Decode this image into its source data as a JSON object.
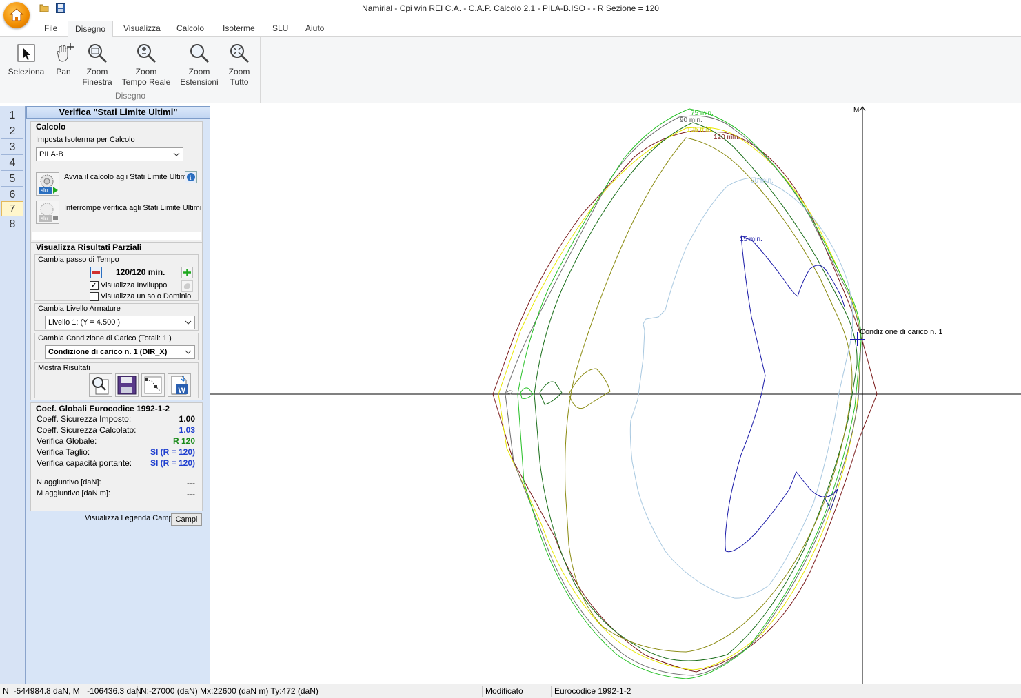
{
  "window": {
    "title": "Namirial - Cpi win REI C.A. -  C.A.P. Calcolo 2.1 - PILA-B.ISO -  - R Sezione = 120"
  },
  "tabs": [
    "File",
    "Disegno",
    "Visualizza",
    "Calcolo",
    "Isoterme",
    "SLU",
    "Aiuto"
  ],
  "ribbon": {
    "group_label": "Disegno",
    "buttons": [
      {
        "l1": "Seleziona",
        "l2": "",
        "icon": "select-arrow-icon"
      },
      {
        "l1": "Pan",
        "l2": "",
        "icon": "pan-hand-icon"
      },
      {
        "l1": "Zoom",
        "l2": "Finestra",
        "icon": "zoom-window-icon"
      },
      {
        "l1": "Zoom",
        "l2": "Tempo Reale",
        "icon": "zoom-realtime-icon"
      },
      {
        "l1": "Zoom",
        "l2": "Estensioni",
        "icon": "zoom-extents-icon"
      },
      {
        "l1": "Zoom",
        "l2": "Tutto",
        "icon": "zoom-all-icon"
      }
    ]
  },
  "side_tabs": [
    "1",
    "2",
    "3",
    "4",
    "5",
    "6",
    "7",
    "8"
  ],
  "panel": {
    "title": "Verifica \"Stati Limite Ultimi\"",
    "calcolo": {
      "heading": "Calcolo",
      "isoterma_label": "Imposta Isoterma per Calcolo",
      "isoterma_value": "PILA-B",
      "start_label": "Avvia il calcolo agli Stati Limite Ultimi",
      "stop_label": "Interrompe verifica agli Stati Limite Ultimi",
      "slu_text": "slu"
    },
    "parziali": {
      "heading": "Visualizza Risultati Parziali",
      "passo_label": "Cambia passo di Tempo",
      "passo_value": "120/120 min.",
      "inviluppo_label": "Visualizza  Inviluppo",
      "inviluppo_checked": true,
      "dominio_label": "Visualizza un solo Dominio",
      "dominio_checked": false,
      "livello_label": "Cambia Livello Armature",
      "livello_value": "Livello 1: (Y =  4.500 )",
      "condizione_label": "Cambia Condizione di Carico  (Totali:  1 )",
      "condizione_value": "Condizione di carico n. 1 (DIR_X)",
      "mostra_label": "Mostra Risultati"
    },
    "coef": {
      "heading": "Coef. Globali Eurocodice 1992-1-2",
      "rows": [
        {
          "label": "Coeff. Sicurezza Imposto:",
          "value": "1.00",
          "color": "#000000"
        },
        {
          "label": "Coeff. Sicurezza Calcolato:",
          "value": "1.03",
          "color": "#1f3fcf"
        },
        {
          "label": "Verifica Globale:",
          "value": "R 120",
          "color": "#1a8a1a"
        },
        {
          "label": "Verifica Taglio:",
          "value": "SI (R = 120)",
          "color": "#1f3fcf"
        },
        {
          "label": "Verifica capacità portante:",
          "value": "SI (R = 120)",
          "color": "#1f3fcf"
        }
      ],
      "extra": [
        {
          "label": "N aggiuntivo [daN]:",
          "value": "---"
        },
        {
          "label": "M aggiuntivo [daN m]:",
          "value": "---"
        }
      ]
    },
    "legenda_label": "Visualizza Legenda Campi",
    "campi_button": "Campi"
  },
  "chart": {
    "axis_label": "M",
    "point_label": "Condizione di carico n. 1",
    "curve_labels": [
      "75 min.",
      "90 min.",
      "105 min.",
      "120 min.",
      "30 min.",
      "15 min."
    ],
    "colors": {
      "c15": "#1a1aa8",
      "c30": "#a8c8e0",
      "c75": "#26c026",
      "c90": "#6e6e6e",
      "c105": "#e8e800",
      "c120": "#7a1a1a",
      "olive": "#8a8a10",
      "dkgreen": "#1a6e1a"
    }
  },
  "status": {
    "coords": "N=-544984.8 daN, M= -106436.3 daN",
    "loads": "N:-27000 (daN) Mx:22600 (daN m) Ty:472 (daN)",
    "state": "Modificato",
    "norm": "Eurocodice 1992-1-2"
  }
}
